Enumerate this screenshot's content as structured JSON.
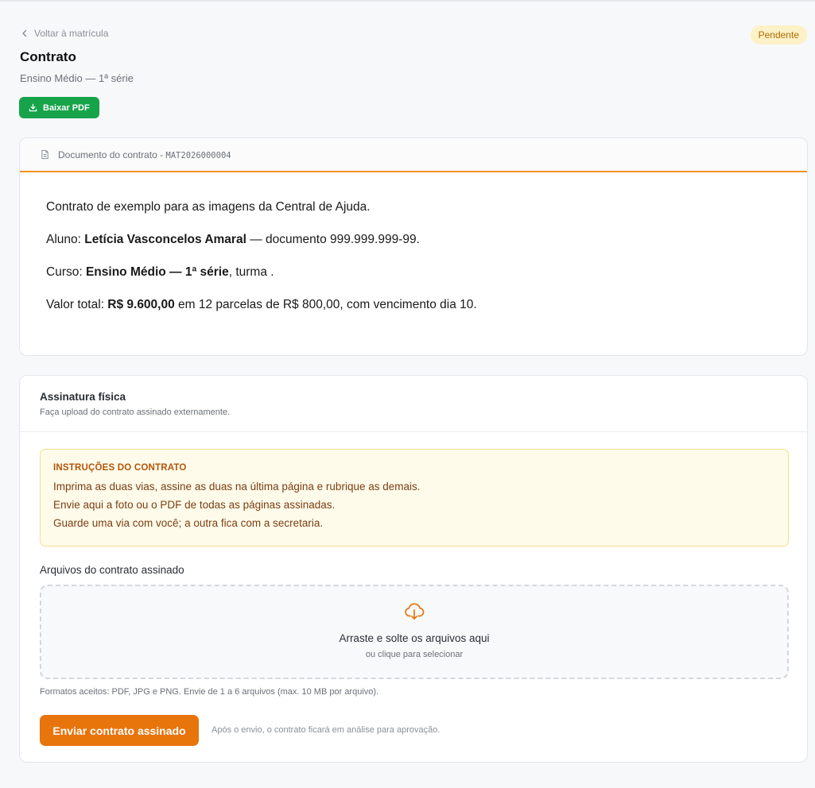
{
  "header": {
    "back_label": "Voltar à matrícula",
    "title": "Contrato",
    "subtitle": "Ensino Médio — 1ª série",
    "status": "Pendente",
    "download_label": "Baixar PDF"
  },
  "contract": {
    "header_label": "Documento do contrato - ",
    "code": "MAT2026000004",
    "line1": "Contrato de exemplo para as imagens da Central de Ajuda.",
    "line2_prefix": "Aluno: ",
    "student_name": "Letícia Vasconcelos Amaral",
    "line2_suffix": " — documento 999.999.999-99.",
    "line3_prefix": "Curso: ",
    "course": "Ensino Médio — 1ª série",
    "line3_suffix": ", turma .",
    "line4_prefix": "Valor total: ",
    "total": "R$ 9.600,00",
    "line4_suffix": " em 12 parcelas de R$ 800,00, com vencimento dia 10."
  },
  "signature": {
    "title": "Assinatura física",
    "description": "Faça upload do contrato assinado externamente.",
    "instructions_title": "INSTRUÇÕES DO CONTRATO",
    "instructions": [
      "Imprima as duas vias, assine as duas na última página e rubrique as demais.",
      "Envie aqui a foto ou o PDF de todas as páginas assinadas.",
      "Guarde uma via com você; a outra fica com a secretaria."
    ],
    "files_label": "Arquivos do contrato assinado",
    "drop_title": "Arraste e solte os arquivos aqui",
    "drop_subtitle": "ou clique para selecionar",
    "formats_hint": "Formatos aceitos: PDF, JPG e PNG. Envie de 1 a 6 arquivos (max. 10 MB por arquivo).",
    "submit_label": "Enviar contrato assinado",
    "submit_hint": "Após o envio, o contrato ficará em análise para aprovação."
  },
  "icons": {
    "back": "chevron-left-icon",
    "download": "download-icon",
    "document": "document-icon",
    "upload": "cloud-upload-icon"
  },
  "colors": {
    "status_bg": "#fdf1c7",
    "status_text": "#b26a00",
    "download_button": "#16a34a",
    "contract_accent": "#f3921e",
    "submit_button": "#e8740c",
    "instructions_bg": "#fffbea",
    "instructions_title": "#b45309"
  }
}
